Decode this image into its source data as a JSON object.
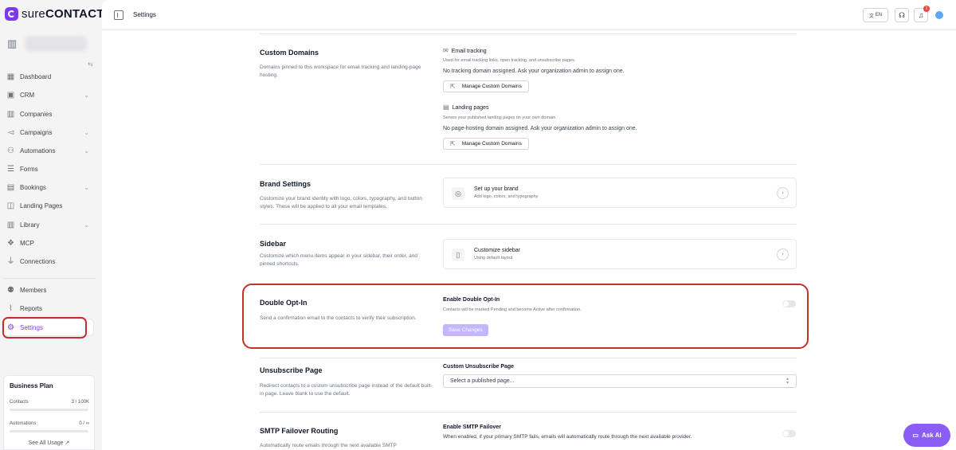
{
  "app": {
    "logo_prefix": "sure",
    "logo_suffix": "CONTACT",
    "collapse_icon": "double-chevron-icon"
  },
  "sidebar": {
    "items": [
      {
        "label": "Dashboard",
        "icon": "dashboard-icon",
        "has_chevron": false
      },
      {
        "label": "CRM",
        "icon": "crm-icon",
        "has_chevron": true
      },
      {
        "label": "Companies",
        "icon": "building-icon",
        "has_chevron": false
      },
      {
        "label": "Campaigns",
        "icon": "megaphone-icon",
        "has_chevron": true
      },
      {
        "label": "Automations",
        "icon": "flow-icon",
        "has_chevron": true
      },
      {
        "label": "Forms",
        "icon": "form-icon",
        "has_chevron": false
      },
      {
        "label": "Bookings",
        "icon": "calendar-icon",
        "has_chevron": true
      },
      {
        "label": "Landing Pages",
        "icon": "layout-icon",
        "has_chevron": false
      },
      {
        "label": "Library",
        "icon": "library-icon",
        "has_chevron": true
      },
      {
        "label": "MCP",
        "icon": "mcp-icon",
        "has_chevron": false
      },
      {
        "label": "Connections",
        "icon": "plug-icon",
        "has_chevron": false
      },
      {
        "label": "Members",
        "icon": "users-icon",
        "has_chevron": false
      },
      {
        "label": "Reports",
        "icon": "chart-icon",
        "has_chevron": false
      },
      {
        "label": "Settings",
        "icon": "gear-icon",
        "has_chevron": false,
        "active": true
      }
    ],
    "chevron": "⌄",
    "plan": {
      "title": "Business Plan",
      "contacts_label": "Contacts",
      "contacts_value": "3 / 100K",
      "contacts_fraction": 0.0,
      "automations_label": "Automations",
      "automations_value": "0 / ∞",
      "automations_fraction": 0.0,
      "see_all": "See All Usage ↗"
    }
  },
  "topbar": {
    "title": "Settings",
    "lang": "EN",
    "notification_count": "1"
  },
  "sections": {
    "custom_domains": {
      "title": "Custom Domains",
      "desc": "Domains pinned to this workspace for email tracking and landing-page hosting.",
      "email_label": "Email tracking",
      "email_sub": "Used for email tracking links, open tracking, and unsubscribe pages.",
      "email_text": "No tracking domain assigned. Ask your organization admin to assign one.",
      "manage_label": "Manage Custom Domains",
      "landing_label": "Landing pages",
      "landing_sub": "Serves your published landing pages on your own domain.",
      "landing_text": "No page-hosting domain assigned. Ask your organization admin to assign one."
    },
    "brand": {
      "title": "Brand Settings",
      "desc": "Customize your brand identity with logo, colors, typography, and button styles. These will be applied to all your email templates.",
      "card_title": "Set up your brand",
      "card_sub": "Add logo, colors, and typography"
    },
    "sidebar_settings": {
      "title": "Sidebar",
      "desc": "Customize which menu items appear in your sidebar, their order, and pinned shortcuts.",
      "card_title": "Customize sidebar",
      "card_sub": "Using default layout"
    },
    "double_optin": {
      "title": "Double Opt-In",
      "desc": "Send a confirmation email to the contacts to verify their subscription.",
      "label": "Enable Double Opt-In",
      "sub": "Contacts will be marked Pending and become Active after confirmation.",
      "save": "Save Changes",
      "enabled": false
    },
    "unsubscribe": {
      "title": "Unsubscribe Page",
      "desc": "Redirect contacts to a custom unsubscribe page instead of the default built-in page. Leave blank to use the default.",
      "label": "Custom Unsubscribe Page",
      "placeholder": "Select a published page..."
    },
    "smtp": {
      "title": "SMTP Failover Routing",
      "desc": "Automatically route emails through the next available SMTP",
      "label": "Enable SMTP Failover",
      "sub": "When enabled, if your primary SMTP fails, emails will automatically route through the next available provider.",
      "enabled": false
    }
  },
  "ask_ai": "Ask AI",
  "colors": {
    "accent": "#7c3aed",
    "highlight": "#c5302a",
    "save_disabled": "#c4b5fd"
  }
}
